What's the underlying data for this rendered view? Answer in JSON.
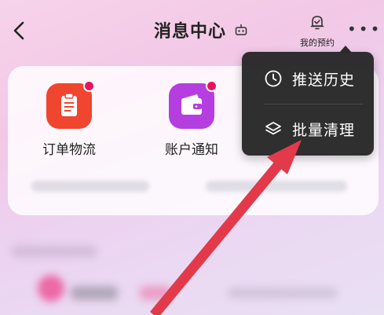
{
  "header": {
    "title": "消息中心",
    "reservation_label": "我的预约"
  },
  "entries": [
    {
      "label": "订单物流",
      "color": "#f0452e",
      "icon": "clipboard-icon",
      "badge": true
    },
    {
      "label": "账户通知",
      "color": "#b53ee0",
      "icon": "wallet-icon",
      "badge": true
    }
  ],
  "menu": {
    "items": [
      {
        "label": "推送历史",
        "icon": "clock-icon"
      },
      {
        "label": "批量清理",
        "icon": "layers-icon"
      }
    ]
  },
  "colors": {
    "accent_red": "#e8135d",
    "popup_bg": "#262628",
    "annotation_arrow": "#e23a4a"
  }
}
